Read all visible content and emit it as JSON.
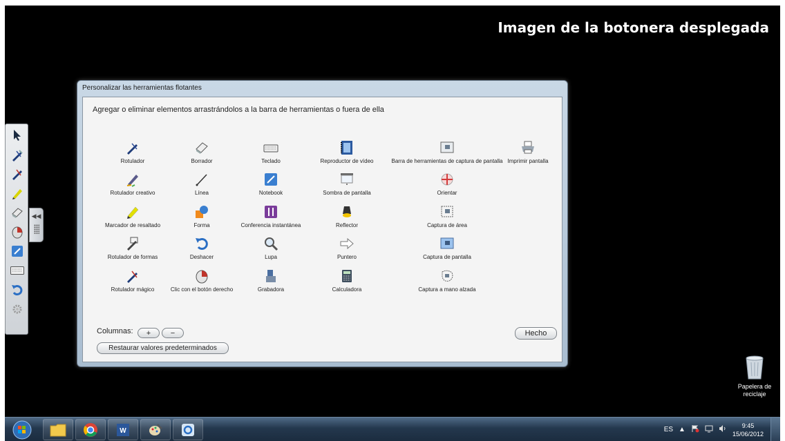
{
  "caption": "Imagen de la botonera desplegada",
  "dialog": {
    "title": "Personalizar las herramientas flotantes",
    "instructions": "Agregar o eliminar elementos arrastrándolos a la barra de herramientas o fuera de ella",
    "columns": [
      [
        "Rotulador",
        "Rotulador creativo",
        "Marcador de resaltado",
        "Rotulador de formas",
        "Rotulador mágico"
      ],
      [
        "Borrador",
        "Línea",
        "Forma",
        "Deshacer",
        "Clic con el botón derecho"
      ],
      [
        "Teclado",
        "Notebook",
        "Conferencia instantánea",
        "Lupa",
        "Grabadora"
      ],
      [
        "Reproductor de vídeo",
        "Sombra de pantalla",
        "Reflector",
        "Puntero",
        "Calculadora"
      ],
      [
        "Barra de herramientas de captura de pantalla",
        "Orientar",
        "Captura de área",
        "Captura de pantalla",
        "Captura a mano alzada"
      ],
      [
        "Imprimir pantalla"
      ]
    ],
    "columns_label": "Columnas:",
    "plus_label": "+",
    "minus_label": "−",
    "restore_label": "Restaurar valores predeterminados",
    "done_label": "Hecho"
  },
  "float_toolbar": {
    "icons": [
      "select-arrow-icon",
      "pen-icon",
      "pen-icon",
      "highlighter-icon",
      "eraser-icon",
      "right-click-icon",
      "notebook-icon",
      "keyboard-icon",
      "undo-icon",
      "gear-icon"
    ]
  },
  "desktop": {
    "recycle_bin_label": "Papelera de reciclaje"
  },
  "taskbar": {
    "apps": [
      "start-orb-icon",
      "explorer-icon",
      "chrome-icon",
      "word-icon",
      "paint-icon",
      "smart-board-icon"
    ],
    "lang": "ES",
    "time": "9:45",
    "date": "15/06/2012"
  }
}
